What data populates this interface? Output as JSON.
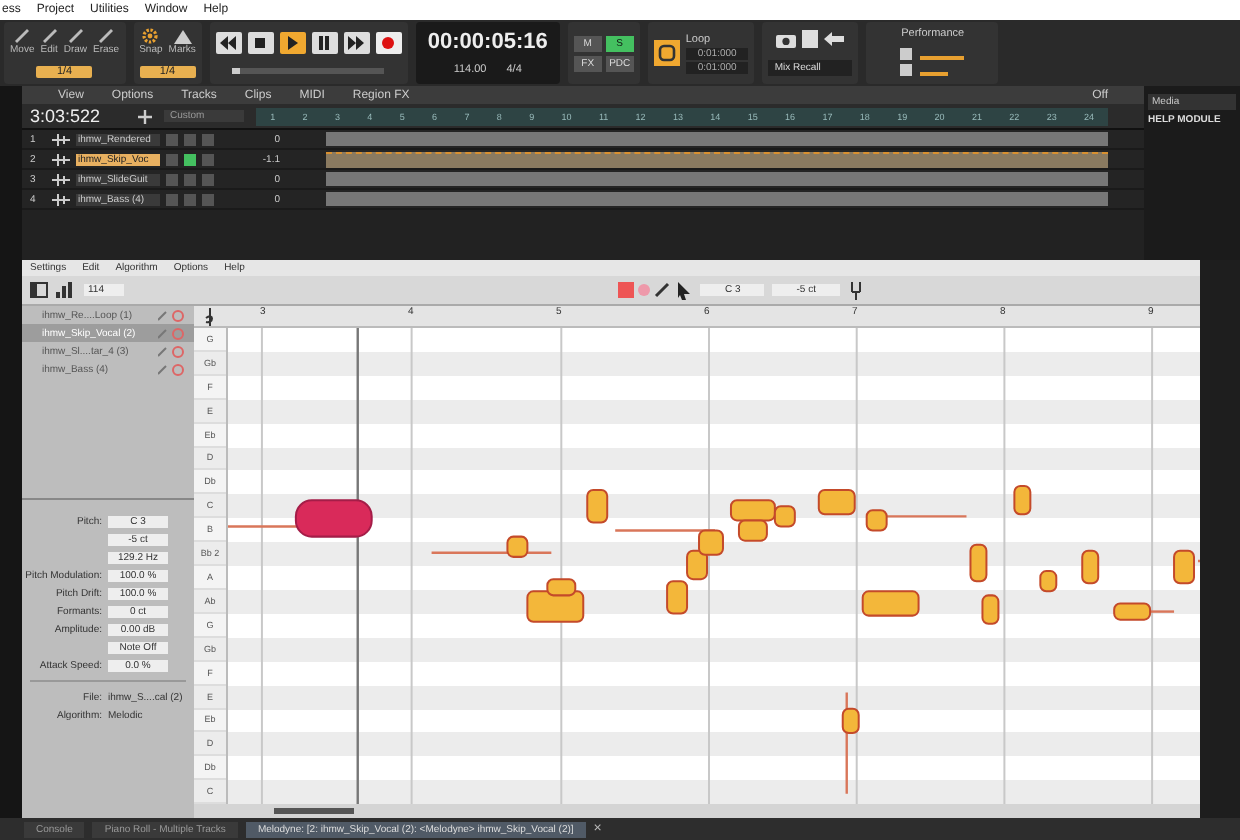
{
  "menu_bar": [
    "ess",
    "Project",
    "Utilities",
    "Window",
    "Help"
  ],
  "toolbar": {
    "tools": [
      {
        "label": "Move"
      },
      {
        "label": "Edit"
      },
      {
        "label": "Draw"
      },
      {
        "label": "Erase"
      }
    ],
    "tool_value": "1/4",
    "snap_label": "Snap",
    "snap_value": "1/4",
    "marks_label": "Marks",
    "transport": [
      {
        "kind": "rewind",
        "selected": false
      },
      {
        "kind": "stop",
        "selected": false
      },
      {
        "kind": "play",
        "selected": true
      },
      {
        "kind": "pause",
        "selected": false
      },
      {
        "kind": "forward",
        "selected": false
      },
      {
        "kind": "record",
        "selected": false
      }
    ],
    "position": {
      "level": 0.05
    },
    "time": "00:00:05:16",
    "tempo": "114.00",
    "meter": "4/4",
    "mix_buttons": [
      {
        "label": "M",
        "on": false
      },
      {
        "label": "S",
        "on": true
      },
      {
        "label": "FX",
        "on": false
      },
      {
        "label": "PDC",
        "on": false
      }
    ],
    "loop": {
      "on": true,
      "title": "Loop",
      "start": "0:01:000",
      "end": "0:01:000"
    },
    "mix_recall": "Mix Recall",
    "performance": "Performance"
  },
  "track_view": {
    "menus": [
      "View",
      "Options",
      "Tracks",
      "Clips",
      "MIDI",
      "Region FX"
    ],
    "now_time": "3:03:522",
    "preset": "Custom",
    "off_label": "Off",
    "ruler": [
      "1",
      "2",
      "3",
      "4",
      "5",
      "6",
      "7",
      "8",
      "9",
      "10",
      "11",
      "12",
      "13",
      "14",
      "15",
      "16",
      "17",
      "18",
      "19",
      "20",
      "21",
      "22",
      "23",
      "24"
    ],
    "tracks": [
      {
        "number": "1",
        "name": "ihmw_Rendered",
        "selected": false,
        "solo": false,
        "volume": "0"
      },
      {
        "number": "2",
        "name": "ihmw_Skip_Voc",
        "selected": true,
        "solo": true,
        "volume": "-1.1"
      },
      {
        "number": "3",
        "name": "ihmw_SlideGuit",
        "selected": false,
        "solo": false,
        "volume": "0"
      },
      {
        "number": "4",
        "name": "ihmw_Bass (4)",
        "selected": false,
        "solo": false,
        "volume": "0"
      }
    ]
  },
  "right_panel": {
    "tab": "Media",
    "title": "HELP MODULE"
  },
  "melodyne": {
    "menus": [
      "Settings",
      "Edit",
      "Algorithm",
      "Options",
      "Help"
    ],
    "tempo": "114",
    "pitch": "C 3",
    "cents": "-5 ct",
    "tracks": [
      {
        "name": "ihmw_Re....Loop (1)",
        "selected": false
      },
      {
        "name": "ihmw_Skip_Vocal (2)",
        "selected": true
      },
      {
        "name": "ihmw_Sl....tar_4 (3)",
        "selected": false
      },
      {
        "name": "ihmw_Bass (4)",
        "selected": false
      }
    ],
    "inspector": [
      {
        "label": "Pitch:",
        "value": "C 3"
      },
      {
        "value": "-5 ct"
      },
      {
        "value": "129.2 Hz"
      },
      {
        "label": "Pitch Modulation:",
        "value": "100.0 %"
      },
      {
        "label": "Pitch Drift:",
        "value": "100.0 %"
      },
      {
        "label": "Formants:",
        "value": "0 ct"
      },
      {
        "label": "Amplitude:",
        "value": "0.00 dB"
      },
      {
        "value": "Note Off"
      },
      {
        "label": "Attack Speed:",
        "value": "0.0 %"
      }
    ],
    "info": [
      {
        "label": "File:",
        "value": "ihmw_S....cal (2)"
      },
      {
        "label": "Algorithm:",
        "value": "Melodic"
      }
    ],
    "bars": [
      "3",
      "4",
      "5",
      "6",
      "7",
      "8",
      "9"
    ],
    "keys": [
      "G",
      "Gb",
      "F",
      "E",
      "Eb",
      "D",
      "Db",
      "C",
      "B",
      "Bb 2",
      "A",
      "Ab",
      "G",
      "Gb",
      "F",
      "E",
      "Eb",
      "D",
      "Db",
      "C"
    ]
  },
  "bottom_tabs": [
    {
      "label": "Console",
      "selected": false
    },
    {
      "label": "Piano Roll - Multiple Tracks",
      "selected": false
    },
    {
      "label": "Melodyne: [2: ihmw_Skip_Vocal (2): <Melodyne> ihmw_Skip_Vocal (2)]",
      "selected": true
    }
  ],
  "close_glyph": "×"
}
